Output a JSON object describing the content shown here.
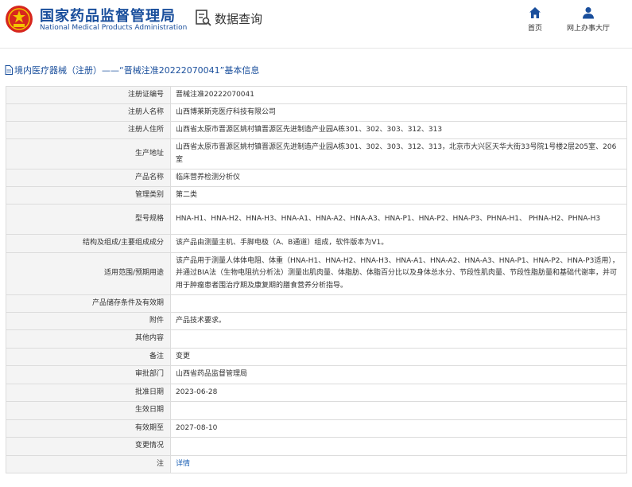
{
  "header": {
    "brand_cn": "国家药品监督管理局",
    "brand_en": "National Medical Products Administration",
    "query_title": "数据查询",
    "nav": [
      {
        "label": "首页",
        "icon": "home-icon"
      },
      {
        "label": "网上办事大厅",
        "icon": "user-icon"
      }
    ]
  },
  "breadcrumb": "境内医疗器械（注册）——“晋械注准20222070041”基本信息",
  "colors": {
    "brand_blue": "#1a4f9c",
    "emblem_red": "#d7261e",
    "label_bg": "#f4f4f4",
    "border": "#dcdcdc",
    "link": "#1a5fb4"
  },
  "fields": {
    "f0": {
      "label": "注册证编号",
      "value": "晋械注准20222070041"
    },
    "f1": {
      "label": "注册人名称",
      "value": "山西博莱斯克医疗科技有限公司"
    },
    "f2": {
      "label": "注册人住所",
      "value": "山西省太原市晋源区姚村镇晋源区先进制造产业园A栋301、302、303、312、313"
    },
    "f3": {
      "label": "生产地址",
      "value": "山西省太原市晋源区姚村镇晋源区先进制造产业园A栋301、302、303、312、313，北京市大兴区天华大街33号院1号楼2层205室、206室"
    },
    "f4": {
      "label": "产品名称",
      "value": "临床营养检测分析仪"
    },
    "f5": {
      "label": "管理类别",
      "value": "第二类"
    },
    "f6": {
      "label": "型号规格",
      "value": "HNA-H1、HNA-H2、HNA-H3、HNA-A1、HNA-A2、HNA-A3、HNA-P1、HNA-P2、HNA-P3、PHNA-H1、 PHNA-H2、PHNA-H3"
    },
    "f7": {
      "label": "结构及组成/主要组成成分",
      "value": "该产品由测量主机、手脚电极（A、B通道）组成，软件版本为V1。"
    },
    "f8": {
      "label": "适用范围/预期用途",
      "value": "该产品用于测量人体体电阻、体重（HNA-H1、HNA-H2、HNA-H3、HNA-A1、HNA-A2、HNA-A3、HNA-P1、HNA-P2、HNA-P3适用），并通过BIA法（生物电阻抗分析法）测量出肌肉量、体脂肪、体脂百分比以及身体总水分、节段性肌肉量、节段性脂肪量和基础代谢率，并可用于肿瘤患者围治疗期及康复期的膳食营养分析指导。"
    },
    "f9": {
      "label": "产品储存条件及有效期",
      "value": ""
    },
    "f10": {
      "label": "附件",
      "value": "产品技术要求。"
    },
    "f11": {
      "label": "其他内容",
      "value": ""
    },
    "f12": {
      "label": "备注",
      "value": "变更"
    },
    "f13": {
      "label": "审批部门",
      "value": "山西省药品监督管理局"
    },
    "f14": {
      "label": "批准日期",
      "value": "2023-06-28"
    },
    "f15": {
      "label": "生效日期",
      "value": ""
    },
    "f16": {
      "label": "有效期至",
      "value": "2027-08-10"
    },
    "f17": {
      "label": "变更情况",
      "value": ""
    },
    "f18": {
      "label": "注",
      "value": "详情"
    }
  }
}
